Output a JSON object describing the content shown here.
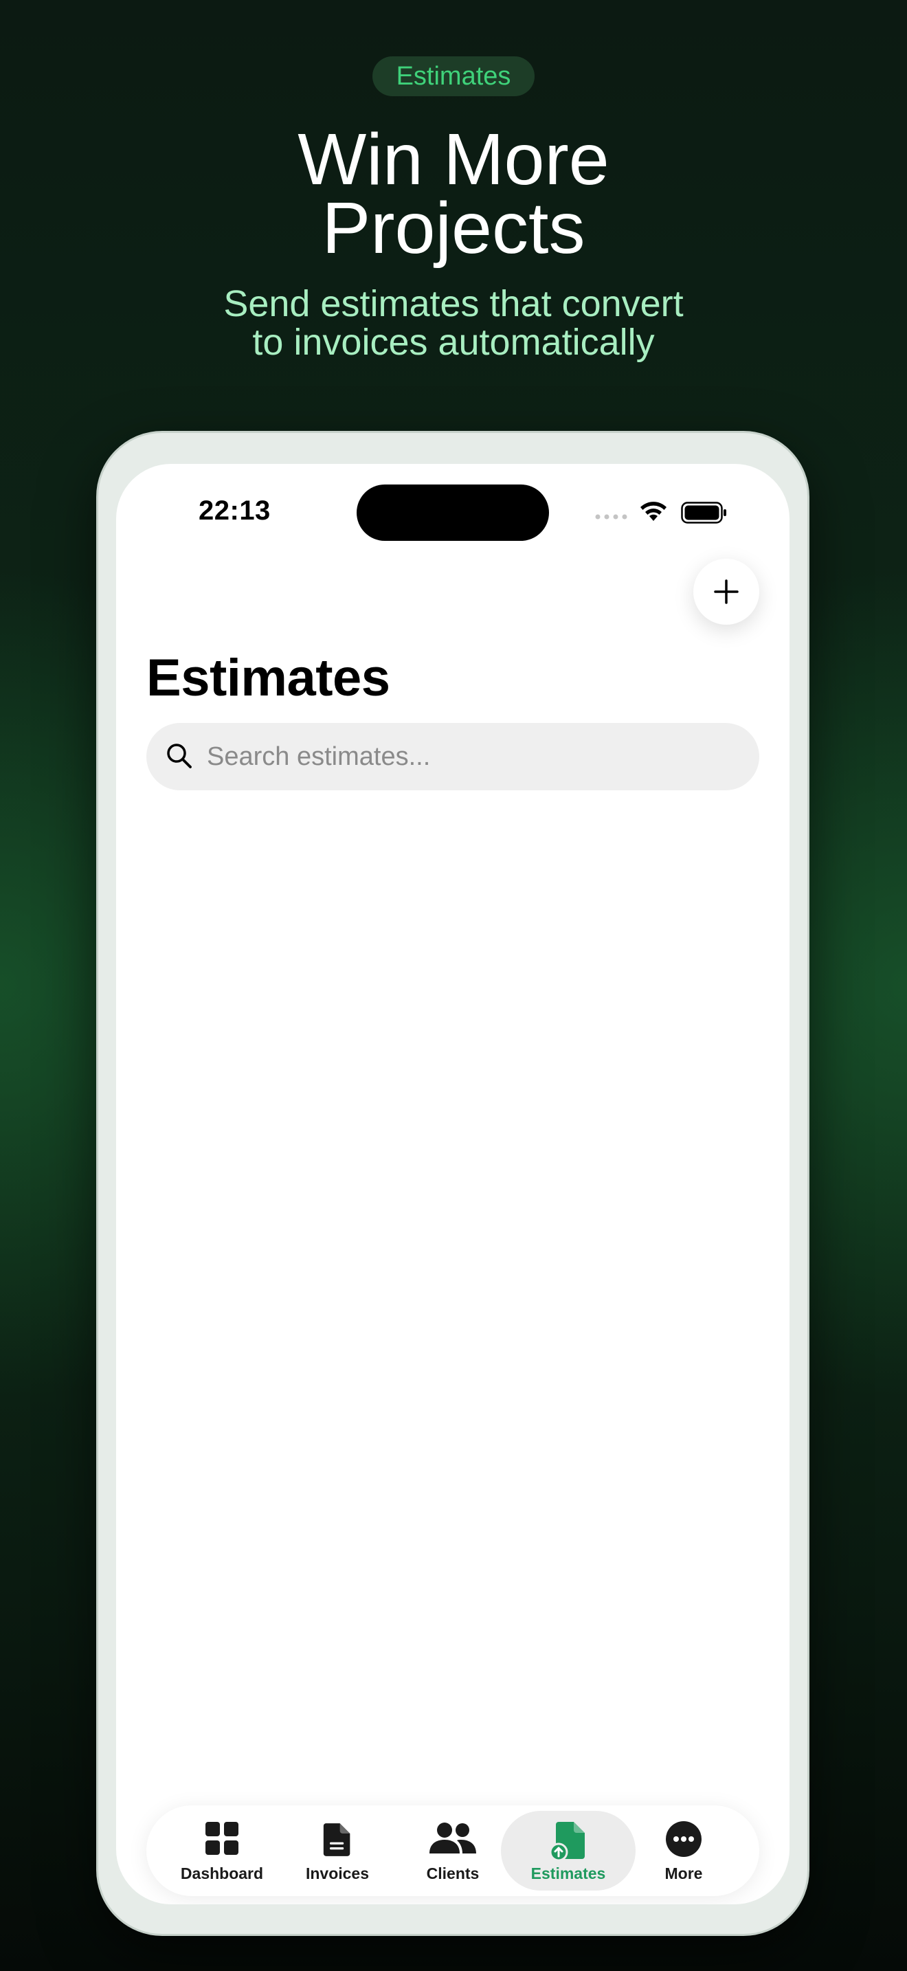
{
  "hero": {
    "badge": "Estimates",
    "title_lines": [
      "Win More",
      "Projects"
    ],
    "subtitle_lines": [
      "Send estimates that convert",
      "to invoices automatically"
    ]
  },
  "status_bar": {
    "time": "22:13",
    "icons": [
      "cellular-signal-icon",
      "wifi-icon",
      "battery-icon"
    ]
  },
  "header": {
    "title": "Estimates",
    "add_button_icon": "plus-icon"
  },
  "search": {
    "placeholder": "Search estimates...",
    "value": "",
    "icon": "search-icon"
  },
  "tabbar": {
    "active_tab": "Estimates",
    "active_color": "#1f9a5e",
    "tabs": [
      {
        "label": "Dashboard",
        "icon": "grid-icon"
      },
      {
        "label": "Invoices",
        "icon": "document-icon"
      },
      {
        "label": "Clients",
        "icon": "people-icon"
      },
      {
        "label": "Estimates",
        "icon": "estimate-document-icon"
      },
      {
        "label": "More",
        "icon": "ellipsis-circle-icon"
      }
    ]
  },
  "colors": {
    "background": "#0d2416",
    "accent": "#3fd27a",
    "subtitle": "#a8eec1"
  }
}
